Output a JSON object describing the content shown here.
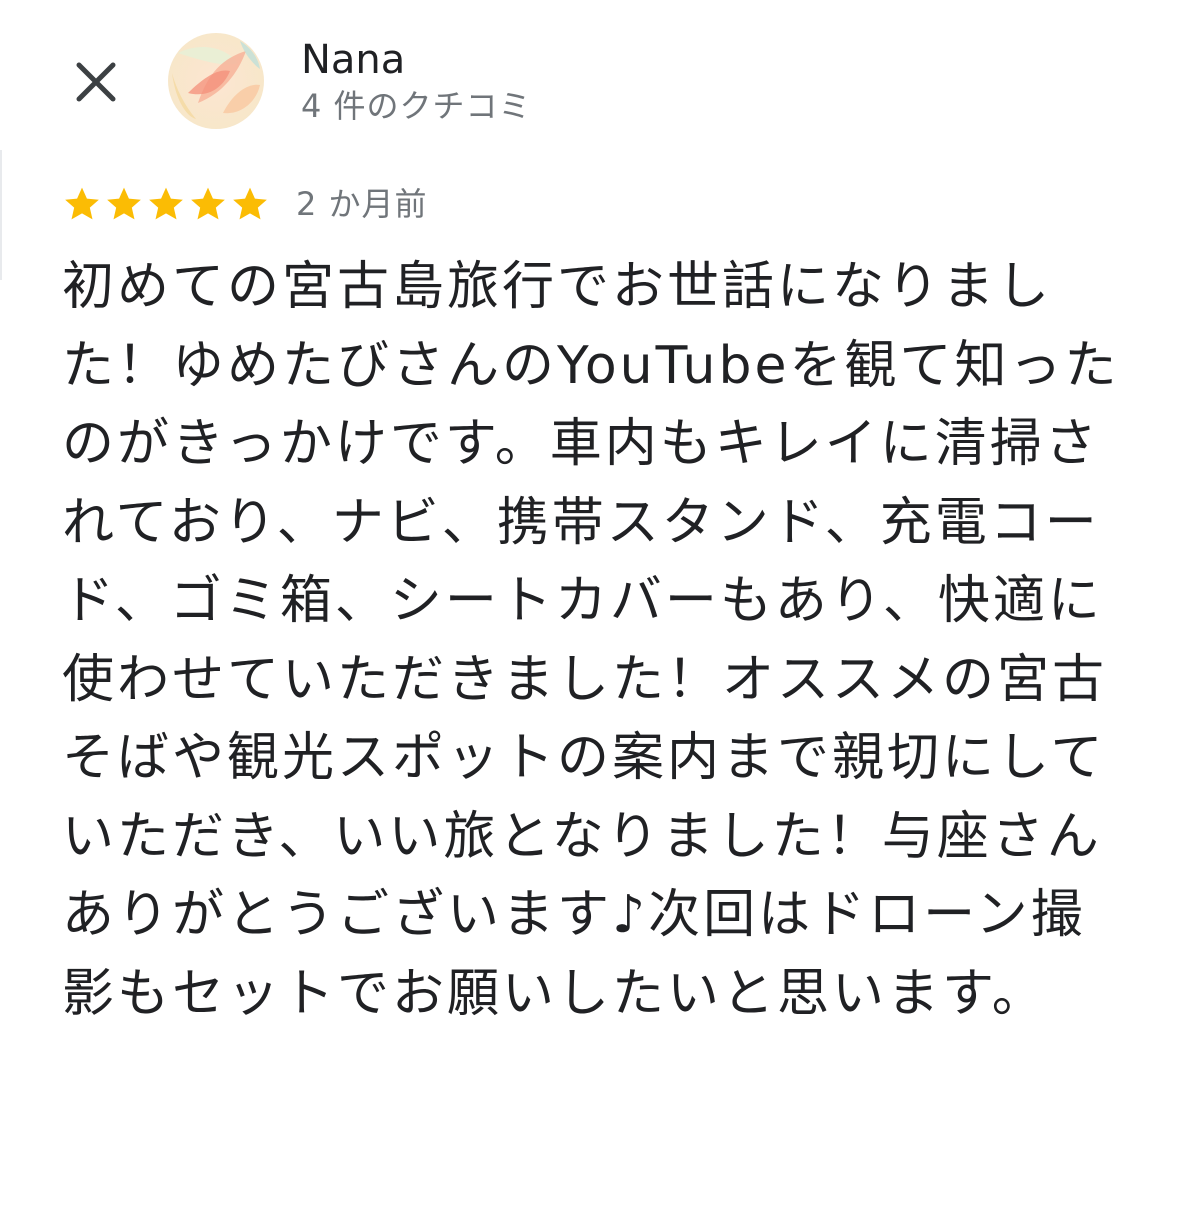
{
  "header": {
    "close_icon": "close-icon",
    "avatar_icon": "avatar-watercolor",
    "user_name": "Nana",
    "review_count": "4 件のクチコミ"
  },
  "review": {
    "rating": 5,
    "max_rating": 5,
    "star_color": "#fbbc04",
    "date": "2 か月前",
    "text": "初めての宮古島旅行でお世話になりました！ゆめたびさんのYouTubeを観て知ったのがきっかけです。車内もキレイに清掃されており、ナビ、携帯スタンド、充電コード、ゴミ箱、シートカバーもあり、快適に使わせていただきました！オススメの宮古そばや観光スポットの案内まで親切にしていただき、いい旅となりました！与座さんありがとうございます♪次回はドローン撮影もセットでお願いしたいと思います。"
  },
  "colors": {
    "primary_text": "#202124",
    "secondary_text": "#70757a",
    "star": "#fbbc04",
    "background": "#ffffff"
  }
}
